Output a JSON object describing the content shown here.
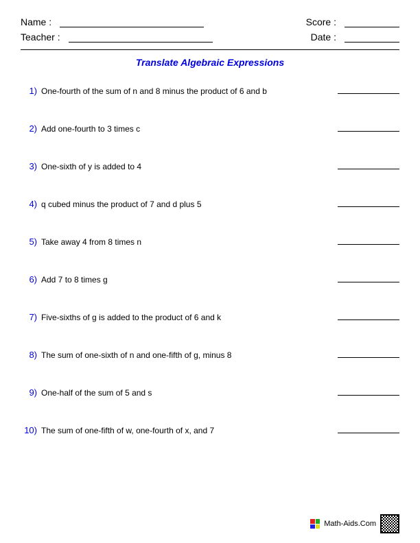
{
  "header": {
    "name_label": "Name :",
    "teacher_label": "Teacher :",
    "score_label": "Score :",
    "date_label": "Date :"
  },
  "title": "Translate Algebraic Expressions",
  "problems": [
    {
      "num": "1)",
      "text": "One-fourth of the sum of n and 8 minus the product of 6 and b"
    },
    {
      "num": "2)",
      "text": "Add one-fourth to 3 times c"
    },
    {
      "num": "3)",
      "text": "One-sixth of y is added to 4"
    },
    {
      "num": "4)",
      "text": "q cubed minus the product of 7 and d plus 5"
    },
    {
      "num": "5)",
      "text": "Take away 4 from 8 times n"
    },
    {
      "num": "6)",
      "text": "Add 7 to 8 times g"
    },
    {
      "num": "7)",
      "text": "Five-sixths of g is added to the product of 6 and k"
    },
    {
      "num": "8)",
      "text": "The sum of one-sixth of n and one-fifth of g, minus 8"
    },
    {
      "num": "9)",
      "text": "One-half of the sum of 5 and s"
    },
    {
      "num": "10)",
      "text": "The sum of one-fifth of w, one-fourth of x, and 7"
    }
  ],
  "footer": {
    "site": "Math-Aids.Com"
  }
}
